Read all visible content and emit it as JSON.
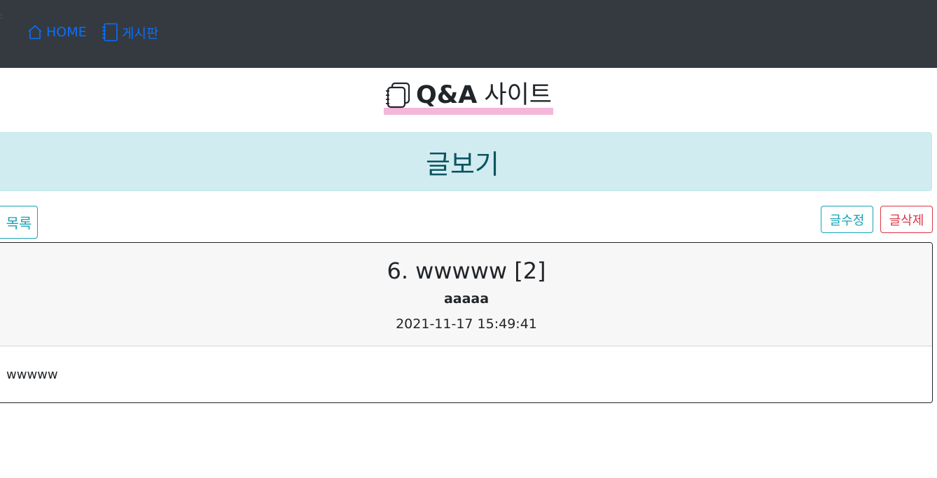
{
  "nav": {
    "home_label": "HOME",
    "board_label": "게시판",
    "accent": "#0d6efd",
    "bg": "#343a40"
  },
  "site": {
    "title_bold": "Q&A",
    "title_rest": "사이트",
    "icon": "notebook-icon"
  },
  "page": {
    "header": "글보기"
  },
  "buttons": {
    "list": "목록",
    "edit": "글수정",
    "delete": "글삭제"
  },
  "post": {
    "title": "6. wwwww [2]",
    "author": "aaaaa",
    "date": "2021-11-17 15:49:41",
    "content": "wwwww"
  },
  "colors": {
    "info": "#17a2b8",
    "danger": "#dc3545",
    "header_bg": "#d1ecf1",
    "highlight": "#f4b6d9"
  }
}
